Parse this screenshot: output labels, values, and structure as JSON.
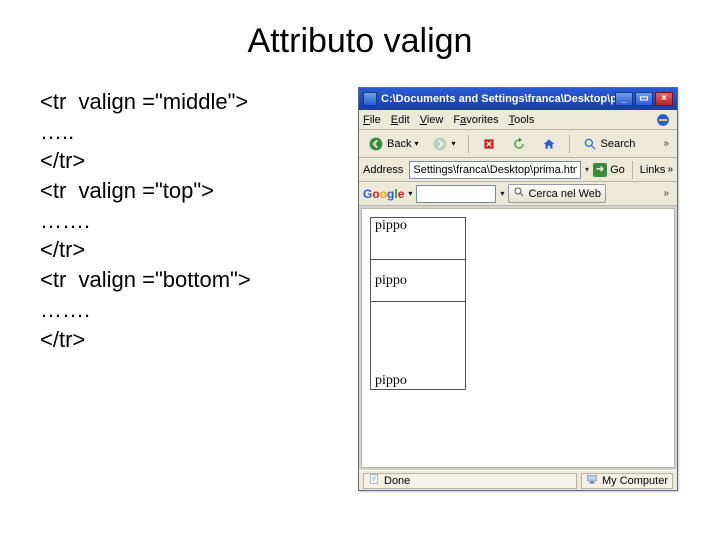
{
  "slide": {
    "title": "Attributo valign",
    "code_lines": [
      "<tr  valign =\"middle\">",
      "…..",
      "</tr>",
      "<tr  valign =\"top\">",
      "…….",
      "</tr>",
      "<tr  valign =\"bottom\">",
      "…….",
      "</tr>"
    ]
  },
  "ie": {
    "titlebar": "C:\\Documents and Settings\\franca\\Desktop\\prima... -",
    "menu": {
      "file": "File",
      "edit": "Edit",
      "view": "View",
      "favorites": "Favorites",
      "tools": "Tools"
    },
    "toolbar": {
      "back": "Back",
      "search": "Search"
    },
    "address": {
      "label": "Address",
      "value": "Settings\\franca\\Desktop\\prima.htm",
      "go": "Go",
      "links": "Links"
    },
    "google": {
      "cerca": "Cerca nel Web"
    },
    "status": {
      "done": "Done",
      "zone": "My Computer"
    },
    "table": {
      "c1": "pippo",
      "c2": "pippo",
      "c3": "pippo"
    }
  }
}
